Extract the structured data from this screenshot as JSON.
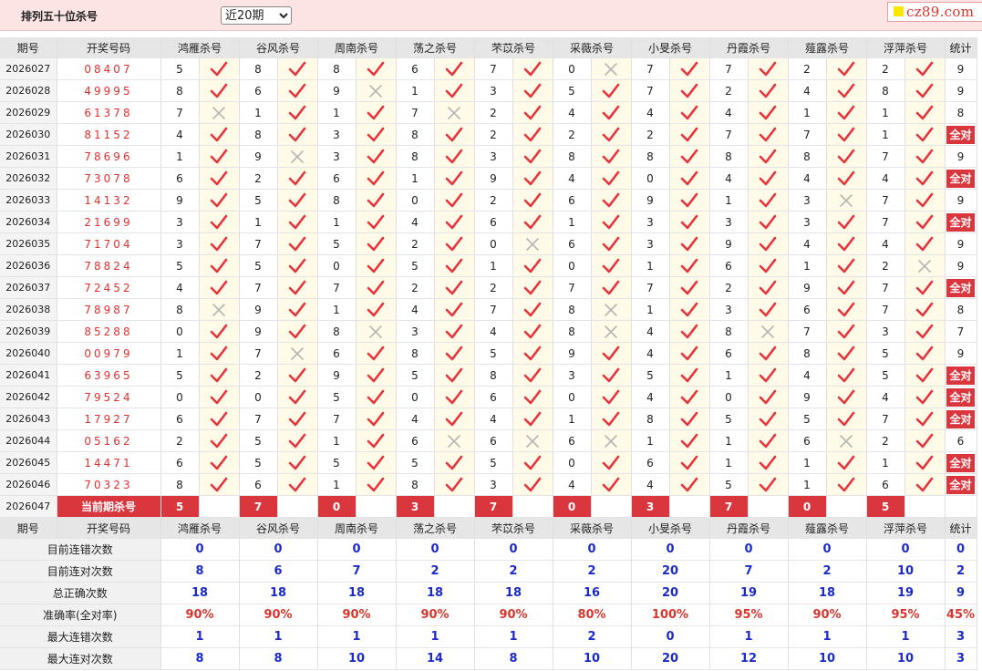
{
  "header": {
    "title": "排列五十位杀号",
    "select_value": "近20期",
    "logo_text": "cz89.com"
  },
  "columns": [
    "期号",
    "开奖号码",
    "鸿雁杀号",
    "谷风杀号",
    "周南杀号",
    "荡之杀号",
    "芣苡杀号",
    "采薇杀号",
    "小旻杀号",
    "丹霞杀号",
    "薤露杀号",
    "浮萍杀号",
    "统计"
  ],
  "rows": [
    {
      "period": "2026027",
      "draw": "08407",
      "kills": [
        "5",
        "8",
        "8",
        "6",
        "7",
        "0",
        "7",
        "7",
        "2",
        "2"
      ],
      "marks": [
        1,
        1,
        1,
        1,
        1,
        0,
        1,
        1,
        1,
        1
      ],
      "stat": "9"
    },
    {
      "period": "2026028",
      "draw": "49995",
      "kills": [
        "8",
        "6",
        "9",
        "1",
        "3",
        "5",
        "7",
        "2",
        "4",
        "8"
      ],
      "marks": [
        1,
        1,
        0,
        1,
        1,
        1,
        1,
        1,
        1,
        1
      ],
      "stat": "9"
    },
    {
      "period": "2026029",
      "draw": "61378",
      "kills": [
        "7",
        "1",
        "1",
        "7",
        "2",
        "4",
        "4",
        "4",
        "1",
        "1"
      ],
      "marks": [
        0,
        1,
        1,
        0,
        1,
        1,
        1,
        1,
        1,
        1
      ],
      "stat": "8"
    },
    {
      "period": "2026030",
      "draw": "81152",
      "kills": [
        "4",
        "8",
        "3",
        "8",
        "2",
        "2",
        "2",
        "7",
        "7",
        "1"
      ],
      "marks": [
        1,
        1,
        1,
        1,
        1,
        1,
        1,
        1,
        1,
        1
      ],
      "stat": "全对"
    },
    {
      "period": "2026031",
      "draw": "78696",
      "kills": [
        "1",
        "9",
        "3",
        "8",
        "3",
        "8",
        "8",
        "8",
        "8",
        "7"
      ],
      "marks": [
        1,
        0,
        1,
        1,
        1,
        1,
        1,
        1,
        1,
        1
      ],
      "stat": "9"
    },
    {
      "period": "2026032",
      "draw": "73078",
      "kills": [
        "6",
        "2",
        "6",
        "1",
        "9",
        "4",
        "0",
        "4",
        "4",
        "4"
      ],
      "marks": [
        1,
        1,
        1,
        1,
        1,
        1,
        1,
        1,
        1,
        1
      ],
      "stat": "全对"
    },
    {
      "period": "2026033",
      "draw": "14132",
      "kills": [
        "9",
        "5",
        "8",
        "0",
        "2",
        "6",
        "9",
        "1",
        "3",
        "7"
      ],
      "marks": [
        1,
        1,
        1,
        1,
        1,
        1,
        1,
        1,
        0,
        1
      ],
      "stat": "9"
    },
    {
      "period": "2026034",
      "draw": "21699",
      "kills": [
        "3",
        "1",
        "1",
        "4",
        "6",
        "1",
        "3",
        "3",
        "3",
        "7"
      ],
      "marks": [
        1,
        1,
        1,
        1,
        1,
        1,
        1,
        1,
        1,
        1
      ],
      "stat": "全对"
    },
    {
      "period": "2026035",
      "draw": "71704",
      "kills": [
        "3",
        "7",
        "5",
        "2",
        "0",
        "6",
        "3",
        "9",
        "4",
        "4"
      ],
      "marks": [
        1,
        1,
        1,
        1,
        0,
        1,
        1,
        1,
        1,
        1
      ],
      "stat": "9"
    },
    {
      "period": "2026036",
      "draw": "78824",
      "kills": [
        "5",
        "5",
        "0",
        "5",
        "1",
        "0",
        "1",
        "6",
        "1",
        "2"
      ],
      "marks": [
        1,
        1,
        1,
        1,
        1,
        1,
        1,
        1,
        1,
        0
      ],
      "stat": "9"
    },
    {
      "period": "2026037",
      "draw": "72452",
      "kills": [
        "4",
        "7",
        "7",
        "2",
        "2",
        "7",
        "7",
        "2",
        "9",
        "7"
      ],
      "marks": [
        1,
        1,
        1,
        1,
        1,
        1,
        1,
        1,
        1,
        1
      ],
      "stat": "全对"
    },
    {
      "period": "2026038",
      "draw": "78987",
      "kills": [
        "8",
        "9",
        "1",
        "4",
        "7",
        "8",
        "1",
        "3",
        "6",
        "7"
      ],
      "marks": [
        0,
        1,
        1,
        1,
        1,
        0,
        1,
        1,
        1,
        1
      ],
      "stat": "8"
    },
    {
      "period": "2026039",
      "draw": "85288",
      "kills": [
        "0",
        "9",
        "8",
        "3",
        "4",
        "8",
        "4",
        "8",
        "7",
        "3"
      ],
      "marks": [
        1,
        1,
        0,
        1,
        1,
        0,
        1,
        0,
        1,
        1
      ],
      "stat": "7"
    },
    {
      "period": "2026040",
      "draw": "00979",
      "kills": [
        "1",
        "7",
        "6",
        "8",
        "5",
        "9",
        "4",
        "6",
        "8",
        "5"
      ],
      "marks": [
        1,
        0,
        1,
        1,
        1,
        1,
        1,
        1,
        1,
        1
      ],
      "stat": "9"
    },
    {
      "period": "2026041",
      "draw": "63965",
      "kills": [
        "5",
        "2",
        "9",
        "5",
        "8",
        "3",
        "5",
        "1",
        "4",
        "5"
      ],
      "marks": [
        1,
        1,
        1,
        1,
        1,
        1,
        1,
        1,
        1,
        1
      ],
      "stat": "全对"
    },
    {
      "period": "2026042",
      "draw": "79524",
      "kills": [
        "0",
        "0",
        "5",
        "0",
        "6",
        "0",
        "4",
        "0",
        "9",
        "4"
      ],
      "marks": [
        1,
        1,
        1,
        1,
        1,
        1,
        1,
        1,
        1,
        1
      ],
      "stat": "全对"
    },
    {
      "period": "2026043",
      "draw": "17927",
      "kills": [
        "6",
        "7",
        "7",
        "4",
        "4",
        "1",
        "8",
        "5",
        "5",
        "7"
      ],
      "marks": [
        1,
        1,
        1,
        1,
        1,
        1,
        1,
        1,
        1,
        1
      ],
      "stat": "全对"
    },
    {
      "period": "2026044",
      "draw": "05162",
      "kills": [
        "2",
        "5",
        "1",
        "6",
        "6",
        "6",
        "1",
        "1",
        "6",
        "2"
      ],
      "marks": [
        1,
        1,
        1,
        0,
        0,
        0,
        1,
        1,
        0,
        1
      ],
      "stat": "6"
    },
    {
      "period": "2026045",
      "draw": "14471",
      "kills": [
        "6",
        "5",
        "5",
        "5",
        "5",
        "0",
        "6",
        "1",
        "1",
        "1"
      ],
      "marks": [
        1,
        1,
        1,
        1,
        1,
        1,
        1,
        1,
        1,
        1
      ],
      "stat": "全对"
    },
    {
      "period": "2026046",
      "draw": "70323",
      "kills": [
        "8",
        "6",
        "1",
        "8",
        "3",
        "4",
        "4",
        "5",
        "1",
        "6"
      ],
      "marks": [
        1,
        1,
        1,
        1,
        1,
        1,
        1,
        1,
        1,
        1
      ],
      "stat": "全对"
    }
  ],
  "current": {
    "period": "2026047",
    "label": "当前期杀号",
    "kills": [
      "5",
      "7",
      "0",
      "3",
      "7",
      "0",
      "3",
      "7",
      "0",
      "5"
    ]
  },
  "stats": [
    {
      "label": "目前连错次数",
      "values": [
        "0",
        "0",
        "0",
        "0",
        "0",
        "0",
        "0",
        "0",
        "0",
        "0",
        "0"
      ],
      "red": false
    },
    {
      "label": "目前连对次数",
      "values": [
        "8",
        "6",
        "7",
        "2",
        "2",
        "2",
        "20",
        "7",
        "2",
        "10",
        "2"
      ],
      "red": false
    },
    {
      "label": "总正确次数",
      "values": [
        "18",
        "18",
        "18",
        "18",
        "18",
        "16",
        "20",
        "19",
        "18",
        "19",
        "9"
      ],
      "red": false
    },
    {
      "label": "准确率(全对率)",
      "values": [
        "90%",
        "90%",
        "90%",
        "90%",
        "90%",
        "80%",
        "100%",
        "95%",
        "90%",
        "95%",
        "45%"
      ],
      "red": true
    },
    {
      "label": "最大连错次数",
      "values": [
        "1",
        "1",
        "1",
        "1",
        "1",
        "2",
        "0",
        "1",
        "1",
        "1",
        "3"
      ],
      "red": false
    },
    {
      "label": "最大连对次数",
      "values": [
        "8",
        "8",
        "10",
        "14",
        "8",
        "10",
        "20",
        "12",
        "10",
        "10",
        "3"
      ],
      "red": false
    }
  ],
  "colors": {
    "check": "#e8333a",
    "cross": "#b5b5b5",
    "accent": "#d9363e",
    "stat_blue": "#1c2bc8"
  },
  "icons": {
    "correct": "check-icon",
    "wrong": "cross-icon"
  }
}
